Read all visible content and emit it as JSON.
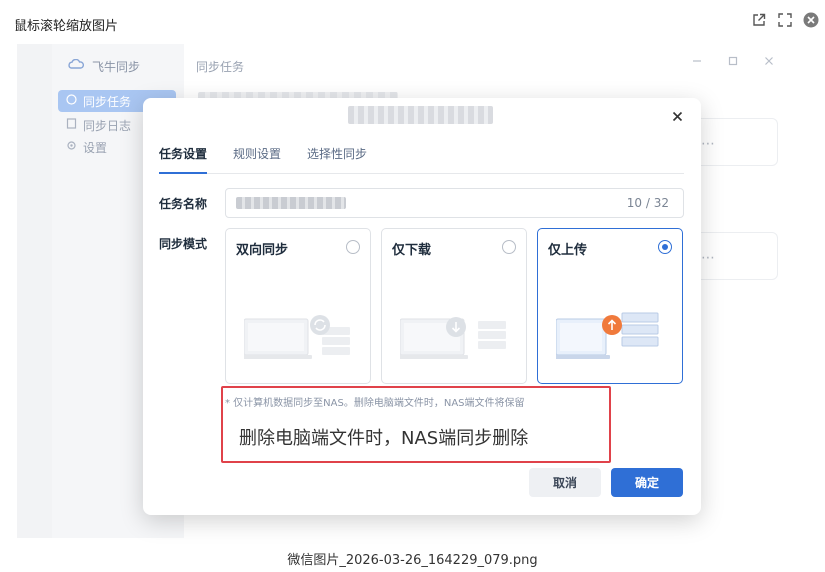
{
  "viewer": {
    "title": "鼠标滚轮缩放图片",
    "filename": "微信图片_2026-03-26_164229_079.png"
  },
  "app": {
    "name": "飞牛同步",
    "nav": [
      {
        "label": "同步任务",
        "active": true
      },
      {
        "label": "同步日志",
        "active": false
      },
      {
        "label": "设置",
        "active": false
      }
    ],
    "main_title": "同步任务"
  },
  "modal": {
    "tabs": [
      "任务设置",
      "规则设置",
      "选择性同步"
    ],
    "active_tab": "任务设置",
    "task_name_label": "任务名称",
    "task_name_counter": "10 / 32",
    "sync_mode_label": "同步模式",
    "modes": [
      {
        "label": "双向同步",
        "selected": false
      },
      {
        "label": "仅下载",
        "selected": false
      },
      {
        "label": "仅上传",
        "selected": true
      }
    ],
    "hint": "* 仅计算机数据同步至NAS。删除电脑端文件时，NAS端文件将保留",
    "annotation": "删除电脑端文件时，NAS端同步删除",
    "cancel_label": "取消",
    "confirm_label": "确定"
  },
  "colors": {
    "accent": "#2f6fd6",
    "annotation_border": "#e0424a",
    "upload_badge": "#f07a3c"
  }
}
